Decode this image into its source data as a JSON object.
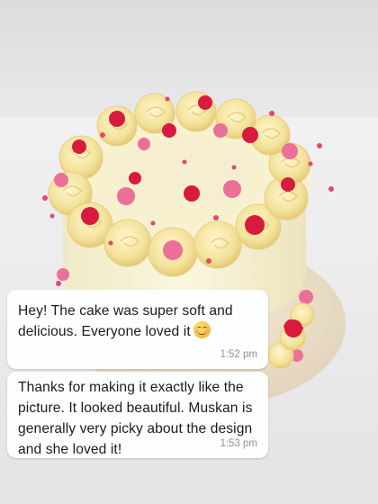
{
  "messages": [
    {
      "text": "Hey! The cake was super soft and delicious. Everyone loved it",
      "emoji": "smiling-face-emoji",
      "time": "1:52 pm"
    },
    {
      "text": "Thanks for making it exactly like the picture. It looked beautiful. Muskan is generally very picky about the design and she loved it!",
      "time": "1:53 pm"
    }
  ],
  "colors": {
    "bubble": "#fdfffe",
    "timestamp": "#8e9295",
    "frosting": "#f6e7a3",
    "flower_red": "#d81b3c",
    "flower_pink": "#ec6f97"
  }
}
